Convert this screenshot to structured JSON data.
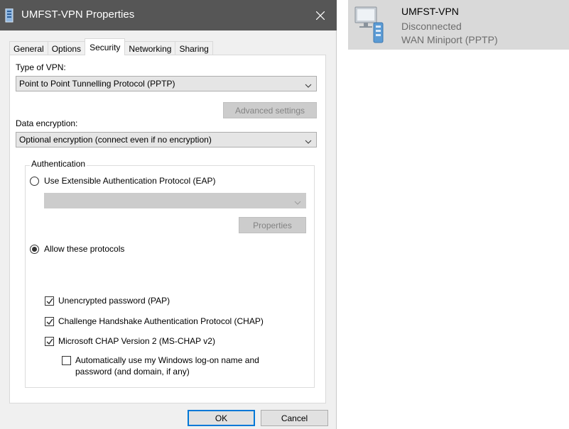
{
  "dialog": {
    "title": "UMFST-VPN Properties",
    "tabs": [
      "General",
      "Options",
      "Security",
      "Networking",
      "Sharing"
    ],
    "active_tab": "Security",
    "type_of_vpn_label": "Type of VPN:",
    "type_of_vpn_value": "Point to Point Tunnelling Protocol (PPTP)",
    "advanced_settings_label": "Advanced settings",
    "data_encryption_label": "Data encryption:",
    "data_encryption_value": "Optional encryption (connect even if no encryption)",
    "authentication": {
      "legend": "Authentication",
      "eap_label": "Use Extensible Authentication Protocol (EAP)",
      "eap_selected": false,
      "eap_dropdown_value": "",
      "properties_label": "Properties",
      "allow_label": "Allow these protocols",
      "allow_selected": true,
      "protocols": [
        {
          "label": "Unencrypted password (PAP)",
          "checked": true
        },
        {
          "label": "Challenge Handshake Authentication Protocol (CHAP)",
          "checked": true
        },
        {
          "label": "Microsoft CHAP Version 2 (MS-CHAP v2)",
          "checked": true
        }
      ],
      "auto_logon_line1": "Automatically use my Windows log-on name and",
      "auto_logon_line2": "password (and domain, if any)",
      "auto_logon_checked": false
    },
    "ok_label": "OK",
    "cancel_label": "Cancel"
  },
  "connection": {
    "name": "UMFST-VPN",
    "status": "Disconnected",
    "device": "WAN Miniport (PPTP)",
    "icon": "vpn-connection-icon"
  },
  "colors": {
    "titlebar": "#565656",
    "dialog_bg": "#f0f0f0",
    "accent": "#0078d7",
    "tile_bg": "#d9d9d9"
  }
}
